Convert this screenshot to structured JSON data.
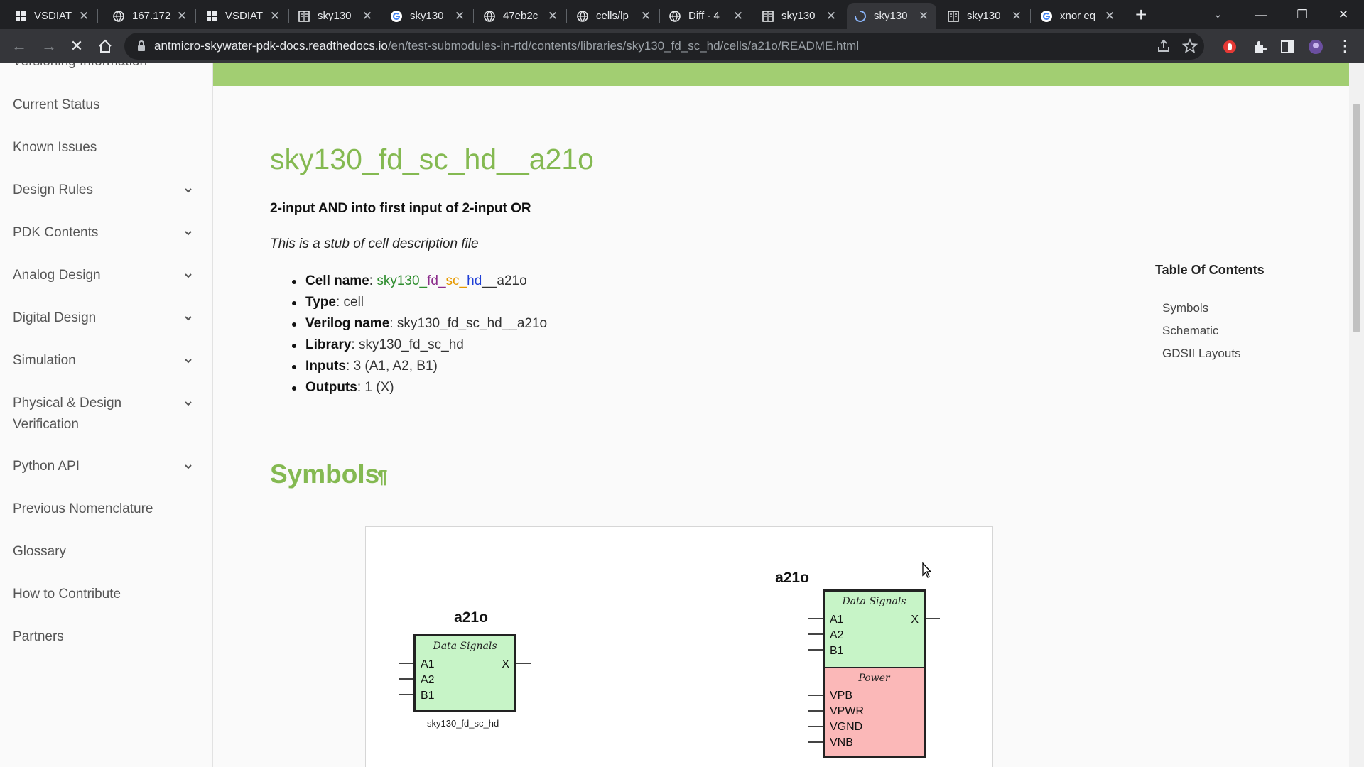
{
  "browser": {
    "tabs": [
      {
        "title": "VSDIAT",
        "icon": "app-grid-icon"
      },
      {
        "title": "167.172",
        "icon": "globe-icon"
      },
      {
        "title": "VSDIAT",
        "icon": "app-grid-icon"
      },
      {
        "title": "sky130_",
        "icon": "docs-book-icon"
      },
      {
        "title": "sky130_",
        "icon": "google-g-icon"
      },
      {
        "title": "47eb2c",
        "icon": "globe-icon"
      },
      {
        "title": "cells/lp",
        "icon": "globe-icon"
      },
      {
        "title": "Diff - 4",
        "icon": "globe-icon"
      },
      {
        "title": "sky130_",
        "icon": "docs-book-icon"
      },
      {
        "title": "sky130_",
        "icon": "loading-spinner-icon",
        "active": true
      },
      {
        "title": "sky130_",
        "icon": "docs-book-icon"
      },
      {
        "title": "xnor eq",
        "icon": "google-g-icon"
      }
    ],
    "url_host": "antmicro-skywater-pdk-docs.readthedocs.io",
    "url_path": "/en/test-submodules-in-rtd/contents/libraries/sky130_fd_sc_hd/cells/a21o/README.html"
  },
  "sidebar": {
    "items": [
      {
        "label": "Versioning Information",
        "expandable": false
      },
      {
        "label": "Current Status",
        "expandable": false
      },
      {
        "label": "Known Issues",
        "expandable": false
      },
      {
        "label": "Design Rules",
        "expandable": true
      },
      {
        "label": "PDK Contents",
        "expandable": true
      },
      {
        "label": "Analog Design",
        "expandable": true
      },
      {
        "label": "Digital Design",
        "expandable": true
      },
      {
        "label": "Simulation",
        "expandable": true
      },
      {
        "label": "Physical & Design",
        "label2": "Verification",
        "expandable": true
      },
      {
        "label": "Python API",
        "expandable": true
      },
      {
        "label": "Previous Nomenclature",
        "expandable": false
      },
      {
        "label": "Glossary",
        "expandable": false
      },
      {
        "label": "How to Contribute",
        "expandable": false
      },
      {
        "label": "Partners",
        "expandable": false
      }
    ]
  },
  "content": {
    "title": "sky130_fd_sc_hd__a21o",
    "subtitle": "2-input AND into first input of 2-input OR",
    "stub": "This is a stub of cell description file",
    "props": {
      "cell_name_label": "Cell name",
      "cell_name_parts": [
        "sky130",
        "_",
        "fd",
        "_",
        "sc",
        "_",
        "hd",
        "__a21o"
      ],
      "type_label": "Type",
      "type_value": "cell",
      "verilog_label": "Verilog name",
      "verilog_value": "sky130_fd_sc_hd__a21o",
      "library_label": "Library",
      "library_value": "sky130_fd_sc_hd",
      "inputs_label": "Inputs",
      "inputs_value": "3 (A1, A2, B1)",
      "outputs_label": "Outputs",
      "outputs_value": "1 (X)"
    },
    "symbols_heading": "Symbols",
    "pilcrow": "¶"
  },
  "toc": {
    "title": "Table Of Contents",
    "links": [
      "Symbols",
      "Schematic",
      "GDSII Layouts"
    ]
  },
  "symbol_small": {
    "title": "a21o",
    "section": "Data Signals",
    "inputs": [
      "A1",
      "A2",
      "B1"
    ],
    "output": "X",
    "library": "sky130_fd_sc_hd"
  },
  "symbol_large": {
    "title": "a21o",
    "data_section": "Data Signals",
    "inputs": [
      "A1",
      "A2",
      "B1"
    ],
    "output": "X",
    "power_section": "Power",
    "power_pins": [
      "VPB",
      "VPWR",
      "VGND",
      "VNB"
    ]
  },
  "colors": {
    "accent_green": "#84b951",
    "top_bar_green": "#a2ce72",
    "data_fill": "#c7f4c7",
    "power_fill": "#fbb8b8"
  }
}
